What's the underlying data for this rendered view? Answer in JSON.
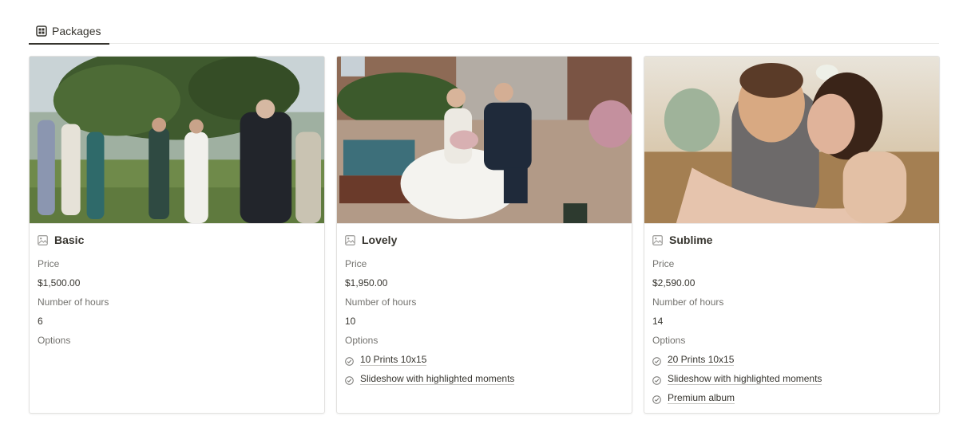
{
  "view": {
    "tab_label": "Packages",
    "tab_icon": "gallery-grid-icon"
  },
  "cards": [
    {
      "title": "Basic",
      "cover": "wedding-guests-celebration-photo",
      "price_label": "Price",
      "price": "$1,500.00",
      "hours_label": "Number of hours",
      "hours": "6",
      "options_label": "Options",
      "options": []
    },
    {
      "title": "Lovely",
      "cover": "couple-seated-with-suitcase-photo",
      "price_label": "Price",
      "price": "$1,950.00",
      "hours_label": "Number of hours",
      "hours": "10",
      "options_label": "Options",
      "options": [
        "10 Prints 10x15",
        "Slideshow with highlighted moments"
      ]
    },
    {
      "title": "Sublime",
      "cover": "couple-embrace-sunset-photo",
      "price_label": "Price",
      "price": "$2,590.00",
      "hours_label": "Number of hours",
      "hours": "14",
      "options_label": "Options",
      "options": [
        "20 Prints 10x15",
        "Slideshow with highlighted moments",
        "Premium album"
      ]
    }
  ]
}
